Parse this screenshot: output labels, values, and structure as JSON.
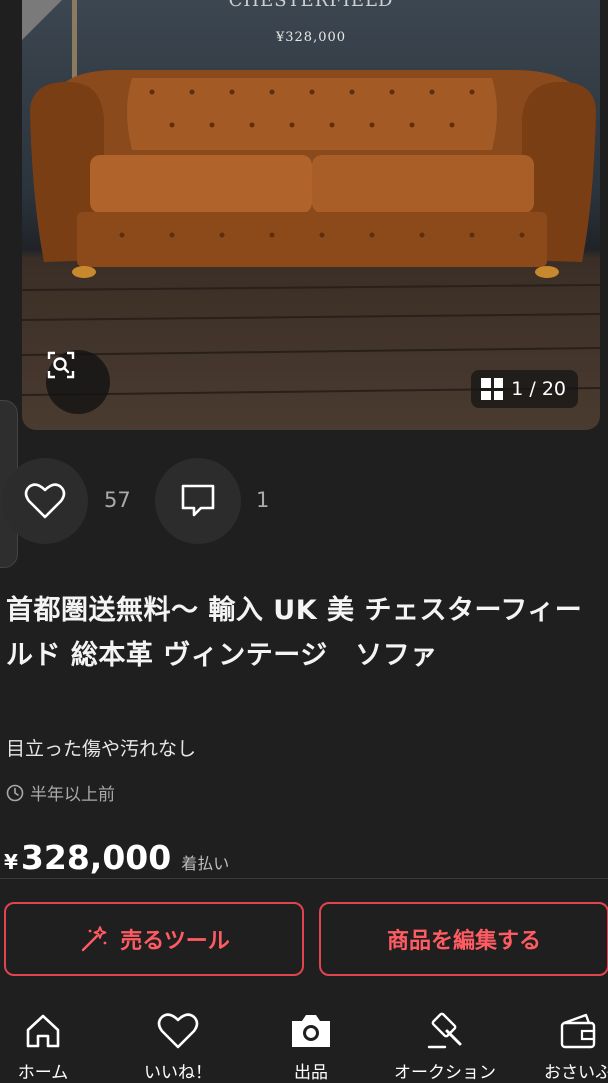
{
  "product_image": {
    "caption_top": "CHESTERFIELD",
    "caption_price": "¥328,000",
    "counter": "1 / 20"
  },
  "actions": {
    "likes_count": "57",
    "comments_count": "1"
  },
  "item": {
    "title": "首都圏送無料〜 輸入 UK 美 チェスターフィールド 総本革 ヴィンテージ　ソファ",
    "description": "目立った傷や汚れなし",
    "posted": "半年以上前",
    "currency": "¥",
    "price": "328,000",
    "shipping": "着払い"
  },
  "buttons": {
    "sell_tool": "売るツール",
    "edit_item": "商品を編集する"
  },
  "nav": {
    "items": [
      {
        "label": "ホーム",
        "icon": "home-icon"
      },
      {
        "label": "いいね！",
        "icon": "heart-icon"
      },
      {
        "label": "出品",
        "icon": "camera-icon"
      },
      {
        "label": "オークション",
        "icon": "gavel-icon"
      },
      {
        "label": "おさいふ",
        "icon": "wallet-icon"
      }
    ]
  },
  "colors": {
    "background": "#1f1f1f",
    "accent": "#e0444f",
    "muted_text": "#aaaaaa"
  }
}
